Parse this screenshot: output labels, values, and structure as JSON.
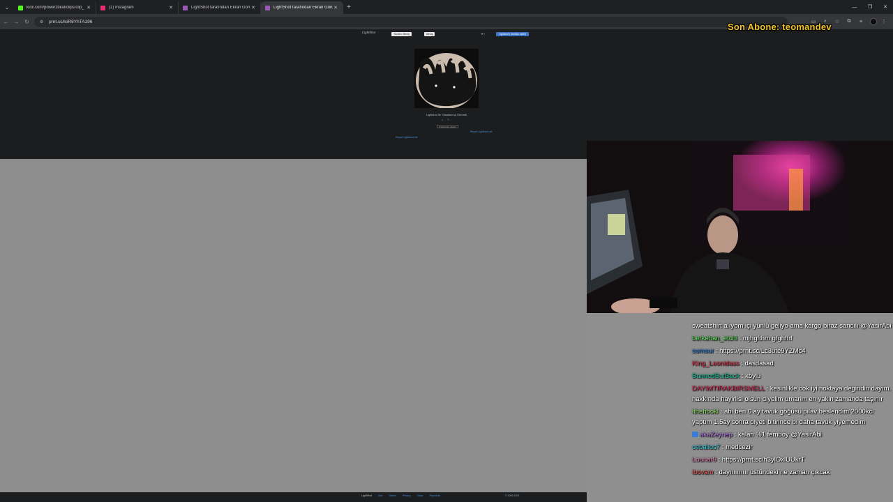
{
  "browser": {
    "tabs": [
      {
        "title": "kick.com/powerzbilal/clips/clip_",
        "favicon_color": "#53fc18",
        "active": false
      },
      {
        "title": "(1) Instagram",
        "favicon_color": "#e1306c",
        "active": false
      },
      {
        "title": "LightShot tarafından Ekran Görü",
        "favicon_color": "#9b59b6",
        "active": false
      },
      {
        "title": "LightShot tarafından Ekran Görü",
        "favicon_color": "#9b59b6",
        "active": true
      }
    ],
    "url": "prnt.sc/lxiR8YhTA196"
  },
  "lightshot": {
    "logo": "LightShot",
    "btn_a": "Yazılım: Mesaj",
    "btn_b": "Mesaj",
    "social": "♥ f",
    "download": "Lightshot'ı ücretsiz indirin",
    "caption": "Lightshot ile Yakalanmış Görüntü",
    "meta": "◷ ... · ☰ ...",
    "comments": "≡ Görünüm yaptım",
    "report_a": "Report Lightshot.net",
    "report_b": "Report Lightshot.net",
    "footer_logo": "LightShot",
    "footer_links": [
      "Ana",
      "Yardım",
      "Privacy",
      "Yazar",
      "Report Ad"
    ],
    "footer_copy": "© 2009-2023"
  },
  "overlay": {
    "son_abone": "Son Abone: teomandev"
  },
  "chat": [
    {
      "user": "",
      "color": "#ffffff",
      "message": "sweatshirt alıyom içi yünlü geliyo ama kargo biraz sancılı @YasirAbi",
      "badge": false
    },
    {
      "user": "berkehan_etchi",
      "color": "#5fe35f",
      "message": "mjhgfthm gfghfhf",
      "badge": false
    },
    {
      "user": "sumsur",
      "color": "#2f7fe0",
      "message": "https://prnt.sc/Lc3ute9YZMc4",
      "badge": false
    },
    {
      "user": "King_Leonidass",
      "color": "#e0314b",
      "message": "dasdasad",
      "badge": false
    },
    {
      "user": "BannedButBack",
      "color": "#18c09a",
      "message": "köylü",
      "badge": false
    },
    {
      "user": "DAYIMTIRAKBIRSMELL",
      "color": "#e0315f",
      "message": "kesinlikle cok iyi noktaya degindin dayım. hakkında hayirlisi olsun diyelim umarim en yakin zamanda taşınır",
      "badge": false
    },
    {
      "user": "lthehookl",
      "color": "#8ee06a",
      "message": "abi ben 6 ay tavuk göğüsü pilav beslendim 2000kcl yaptım 1.5ay sonra diyeti bitirince bi daha tavuk yiyemedim",
      "badge": false
    },
    {
      "user": "akaZeynep",
      "color": "#b77be8",
      "message": "kalan %1 femboy @YasirAbi",
      "badge": true
    },
    {
      "user": "ceballos7",
      "color": "#35c7d8",
      "message": "medcezir",
      "badge": false
    },
    {
      "user": "Lounar0",
      "color": "#e07aa8",
      "message": "https://prnt.sc/h3ylOxlUUkrT",
      "badge": false
    },
    {
      "user": "ibovam",
      "color": "#e05a5a",
      "message": "dayıııııııııı üstündeki ne zaman çıkcak",
      "badge": false
    }
  ]
}
